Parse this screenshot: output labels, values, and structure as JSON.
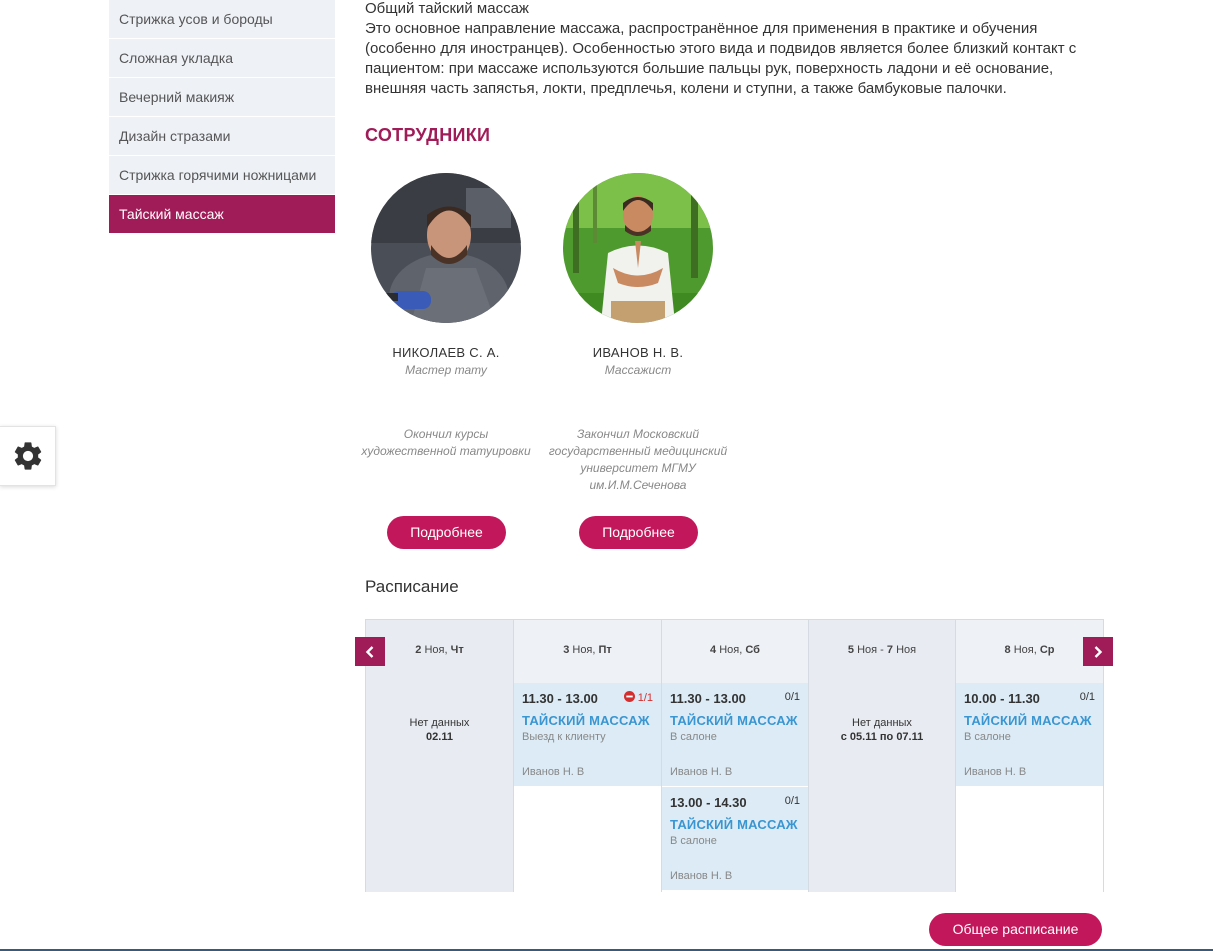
{
  "sidebar": {
    "items": [
      {
        "label": "Стрижка усов и бороды"
      },
      {
        "label": "Сложная укладка"
      },
      {
        "label": "Вечерний макияж"
      },
      {
        "label": "Дизайн стразами"
      },
      {
        "label": "Стрижка горячими ножницами"
      },
      {
        "label": "Тайский массаж",
        "active": true
      }
    ]
  },
  "main": {
    "desc_title": "Общий тайский массаж",
    "description": "Это основное направление массажа, распространённое для применения в практике и обучения (особенно для иностранцев). Особенностью этого вида и подвидов является более близкий контакт с пациентом: при массаже используются большие пальцы рук, поверхность ладони и её основание, внешняя часть запястья, локти, предплечья, колени и ступни, а также бамбуковые палочки.",
    "staff_title": "СОТРУДНИКИ",
    "staff": [
      {
        "name": "НИКОЛАЕВ С. А.",
        "role": "Мастер тату",
        "education": "Окончил курсы художественной татуировки",
        "button": "Подробнее"
      },
      {
        "name": "ИВАНОВ Н. В.",
        "role": "Массажист",
        "education": "Закончил Московский государственный медицинский университет МГМУ им.И.М.Сеченова",
        "button": "Подробнее"
      }
    ],
    "schedule_title": "Расписание",
    "schedule": {
      "columns": [
        {
          "day": "2",
          "month": "Ноя,",
          "weekday": "Чт",
          "nodata": "Нет данных",
          "nodata_date": "02.11"
        },
        {
          "day": "3",
          "month": "Ноя,",
          "weekday": "Пт"
        },
        {
          "day": "4",
          "month": "Ноя,",
          "weekday": "Сб"
        },
        {
          "day": "5",
          "month": "Ноя - ",
          "day2": "7",
          "month2": "Ноя",
          "nodata": "Нет данных",
          "nodata_date": "с 05.11 по 07.11"
        },
        {
          "day": "8",
          "month": "Ноя,",
          "weekday": "Ср"
        }
      ],
      "slots": [
        {
          "time": "11.30 - 13.00",
          "count": "1/1",
          "service": "ТАЙСКИЙ МАССАЖ",
          "location": "Выезд к клиенту",
          "employee": "Иванов Н. В"
        },
        {
          "time": "11.30 - 13.00",
          "count": "0/1",
          "service": "ТАЙСКИЙ МАССАЖ",
          "location": "В салоне",
          "employee": "Иванов Н. В"
        },
        {
          "time": "13.00 - 14.30",
          "count": "0/1",
          "service": "ТАЙСКИЙ МАССАЖ",
          "location": "В салоне",
          "employee": "Иванов Н. В"
        },
        {
          "time": "10.00 - 11.30",
          "count": "0/1",
          "service": "ТАЙСКИЙ МАССАЖ",
          "location": "В салоне",
          "employee": "Иванов Н. В"
        }
      ]
    },
    "all_schedule_button": "Общее расписание"
  },
  "colors": {
    "accent": "#a01c58",
    "button": "#c2185b",
    "link": "#3a96d1"
  },
  "icons": {
    "settings": "gear-icon",
    "prev": "chevron-left-icon",
    "next": "chevron-right-icon",
    "full": "minus-circle-icon"
  }
}
